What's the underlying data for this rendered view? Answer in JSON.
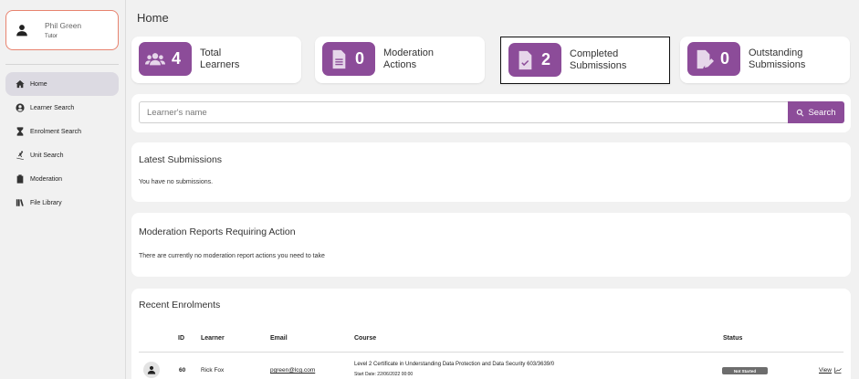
{
  "user": {
    "name": "Phil Green",
    "role": "Tutor"
  },
  "nav": [
    {
      "label": "Home",
      "icon": "home-icon",
      "active": true
    },
    {
      "label": "Learner Search",
      "icon": "person-circle-icon"
    },
    {
      "label": "Enrolment Search",
      "icon": "hourglass-icon"
    },
    {
      "label": "Unit Search",
      "icon": "skier-icon"
    },
    {
      "label": "Moderation",
      "icon": "clipboard-icon"
    },
    {
      "label": "File Library",
      "icon": "library-books-icon"
    }
  ],
  "page_title": "Home",
  "stats": [
    {
      "count": "4",
      "line1": "Total",
      "line2": "Learners",
      "icon": "people-group-icon"
    },
    {
      "count": "0",
      "line1": "Moderation",
      "line2": "Actions",
      "icon": "document-lines-icon"
    },
    {
      "count": "2",
      "line1": "Completed",
      "line2": "Submissions",
      "icon": "document-check-icon"
    },
    {
      "count": "0",
      "line1": "Outstanding",
      "line2": "Submissions",
      "icon": "document-edit-icon"
    }
  ],
  "search": {
    "placeholder": "Learner's name",
    "button": "Search"
  },
  "latest_submissions": {
    "title": "Latest Submissions",
    "empty": "You have no submissions."
  },
  "moderation_reports": {
    "title": "Moderation Reports Requiring Action",
    "empty": "There are currently no moderation report actions you need to take"
  },
  "recent_enrolments": {
    "title": "Recent Enrolments",
    "headers": {
      "id": "ID",
      "learner": "Learner",
      "email": "Email",
      "course": "Course",
      "status": "Status"
    },
    "rows": [
      {
        "id": "60",
        "learner": "Rick Fox",
        "email": "pgreen@lcg.com",
        "course": "Level 2 Certificate in Understanding Data Protection and Data Security 603/3639/0",
        "start": "Start Date: 22/06/2022 00:00",
        "status": "Not Started",
        "view": "View"
      }
    ]
  },
  "colors": {
    "accent": "#8c4c99",
    "user_card_border": "#e8836f"
  }
}
